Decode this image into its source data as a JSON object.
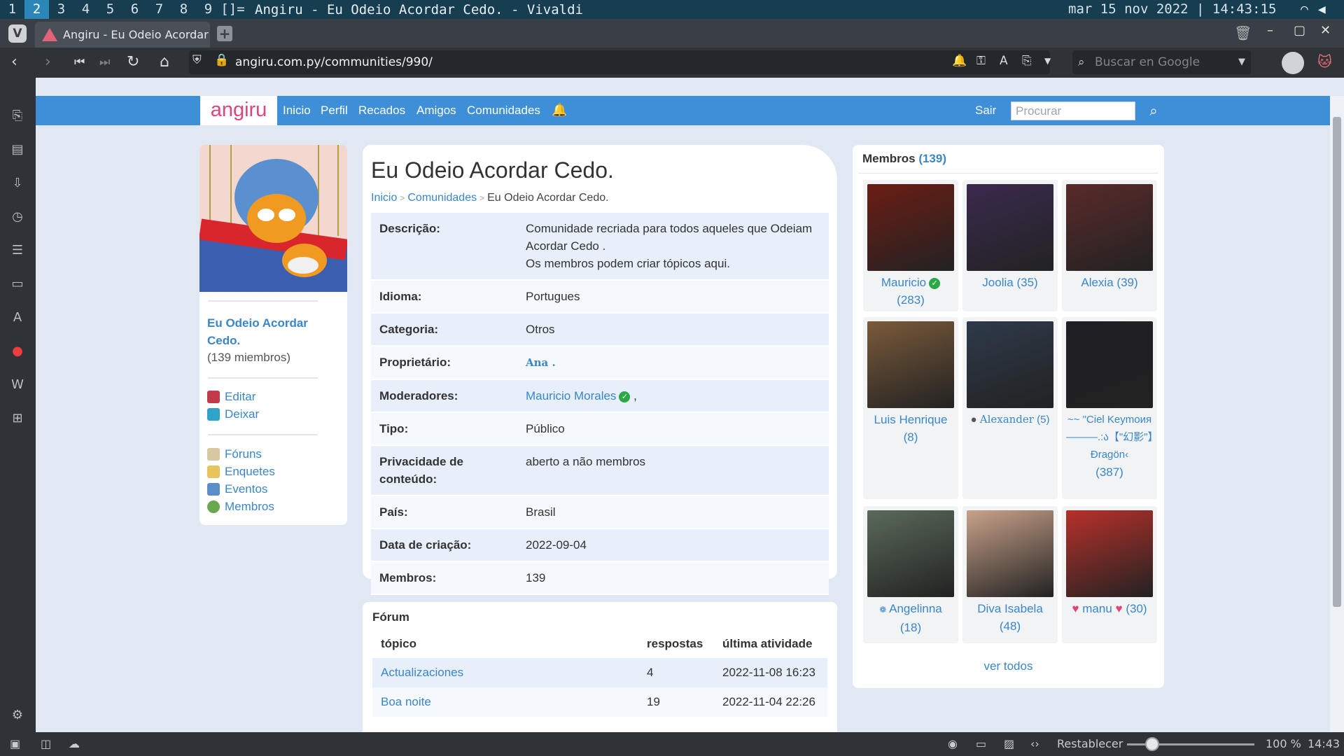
{
  "os": {
    "workspaces": [
      "1",
      "2",
      "3",
      "4",
      "5",
      "6",
      "7",
      "8",
      "9",
      "[]="
    ],
    "active_workspace": "2",
    "window_title": "Angiru - Eu Odeio Acordar Cedo. - Vivaldi",
    "clock": "mar 15 nov 2022 | 14:43:15"
  },
  "browser": {
    "tab_title": "Angiru - Eu Odeio Acordar C",
    "url": "angiru.com.py/communities/990/",
    "search_placeholder": "Buscar en Google",
    "status_reset": "Restablecer",
    "zoom": "100 %",
    "status_time": "14:43"
  },
  "site": {
    "logo": "angiru",
    "nav": [
      "Inicio",
      "Perfil",
      "Recados",
      "Amigos",
      "Comunidades"
    ],
    "logout": "Sair",
    "search_placeholder": "Procurar"
  },
  "community": {
    "name": "Eu Odeio Acordar Cedo.",
    "count": "(139 miembros)",
    "actions": [
      "Editar",
      "Deixar"
    ],
    "links": [
      "Fóruns",
      "Enquetes",
      "Eventos",
      "Membros"
    ]
  },
  "main": {
    "title": "Eu Odeio Acordar Cedo.",
    "breadcrumb": [
      "Inicio",
      "Comunidades",
      "Eu Odeio Acordar Cedo."
    ],
    "info": [
      {
        "key": "Descrição:",
        "lines": [
          "Comunidade recriada para todos aqueles que Odeiam Acordar Cedo .",
          "Os membros podem criar tópicos aqui."
        ]
      },
      {
        "key": "Idioma:",
        "value": "Portugues"
      },
      {
        "key": "Categoria:",
        "value": "Otros"
      },
      {
        "key": "Proprietário:",
        "value": "Ana ."
      },
      {
        "key": "Moderadores:",
        "value": "Mauricio Morales",
        "suffix": ","
      },
      {
        "key": "Tipo:",
        "value": "Público"
      },
      {
        "key": "Privacidade de conteúdo:",
        "value": "aberto a não membros"
      },
      {
        "key": "País:",
        "value": "Brasil"
      },
      {
        "key": "Data de criação:",
        "value": "2022-09-04"
      },
      {
        "key": "Membros:",
        "value": "139"
      }
    ]
  },
  "forum": {
    "title": "Fórum",
    "headers": [
      "tópico",
      "respostas",
      "última atividade"
    ],
    "rows": [
      {
        "topic": "Actualizaciones",
        "replies": "4",
        "last": "2022-11-08 16:23"
      },
      {
        "topic": "Boa noite",
        "replies": "19",
        "last": "2022-11-04 22:26"
      }
    ]
  },
  "members": {
    "label": "Membros",
    "count": "(139)",
    "list": [
      {
        "name": "Mauricio",
        "count": "(283)",
        "verified": true,
        "color": "#6b1d14"
      },
      {
        "name": "Joolia",
        "count": "(35)",
        "color": "#3a2a4e"
      },
      {
        "name": "Alexia",
        "count": "(39)",
        "color": "#5a2a2a"
      },
      {
        "name": "Luis Henrique",
        "count": "(8)",
        "color": "#7a5a3a"
      },
      {
        "name": "Alexander",
        "count": "(5)",
        "color": "#2e3a4a"
      },
      {
        "name": "~~ \"Ciel Keymoия ———.:ა【\"幻影\"】Ɖragön‹",
        "count": "(387)",
        "color": "#1e1e24"
      },
      {
        "name": "Angelinna",
        "count": "(18)",
        "color": "#5a6a5a"
      },
      {
        "name": "Diva Isabela",
        "count": "(48)",
        "color": "#c9a28a"
      },
      {
        "name": "manu",
        "count": "(30)",
        "color": "#b8302a"
      }
    ],
    "see_all": "ver todos"
  }
}
